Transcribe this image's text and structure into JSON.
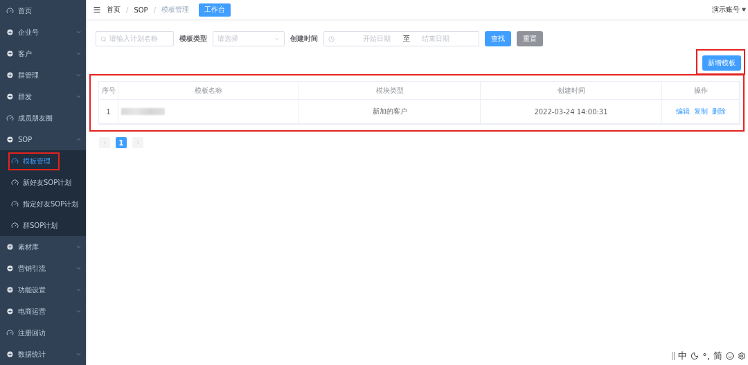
{
  "sidebar": {
    "items": [
      {
        "label": "首页",
        "kind": "link",
        "selected": false
      },
      {
        "label": "企业号",
        "kind": "group",
        "expanded": false,
        "selected": false
      },
      {
        "label": "客户",
        "kind": "group",
        "expanded": false,
        "selected": false
      },
      {
        "label": "群管理",
        "kind": "group",
        "expanded": false,
        "selected": false
      },
      {
        "label": "群发",
        "kind": "group",
        "expanded": false,
        "selected": false
      },
      {
        "label": "成员朋友圈",
        "kind": "link",
        "selected": false
      },
      {
        "label": "SOP",
        "kind": "group",
        "expanded": true,
        "selected": false,
        "children": [
          {
            "label": "模板管理",
            "selected": true,
            "highlighted": true
          },
          {
            "label": "新好友SOP计划",
            "selected": false,
            "highlighted": false
          },
          {
            "label": "指定好友SOP计划",
            "selected": false,
            "highlighted": false
          },
          {
            "label": "群SOP计划",
            "selected": false,
            "highlighted": false
          }
        ]
      },
      {
        "label": "素材库",
        "kind": "group",
        "expanded": false,
        "selected": false
      },
      {
        "label": "营销引流",
        "kind": "group",
        "expanded": false,
        "selected": false
      },
      {
        "label": "功能设置",
        "kind": "group",
        "expanded": false,
        "selected": false
      },
      {
        "label": "电商运营",
        "kind": "group",
        "expanded": false,
        "selected": false
      },
      {
        "label": "注册回访",
        "kind": "link",
        "selected": false
      },
      {
        "label": "数据统计",
        "kind": "group",
        "expanded": false,
        "selected": false
      }
    ]
  },
  "header": {
    "breadcrumb": [
      "首页",
      "SOP",
      "模板管理"
    ],
    "breadcrumb_separators": [
      "/",
      "/"
    ],
    "workbench_button": "工作台",
    "account": "演示账号"
  },
  "filters": {
    "name_placeholder": "请输入计划名称",
    "type_label": "模板类型",
    "type_placeholder": "请选择",
    "time_label": "创建时间",
    "start_placeholder": "开始日期",
    "range_separator": "至",
    "end_placeholder": "结束日期",
    "search_button": "查找",
    "reset_button": "重置"
  },
  "new_button": {
    "label": "新增模板",
    "highlighted": true
  },
  "table": {
    "highlighted": true,
    "columns": [
      "序号",
      "模板名称",
      "模块类型",
      "创建时间",
      "操作"
    ],
    "rows": [
      {
        "index": "1",
        "name_blurred": true,
        "type": "新加的客户",
        "created": "2022-03-24 14:00:31",
        "actions": [
          "编辑",
          "复制",
          "删除"
        ]
      }
    ]
  },
  "pagination": {
    "pages": [
      {
        "label": "1",
        "selected": true
      }
    ]
  },
  "ime_bar": {
    "items": [
      {
        "kind": "text",
        "label": "中"
      },
      {
        "kind": "moon"
      },
      {
        "kind": "text",
        "label": "°,"
      },
      {
        "kind": "text",
        "label": "简"
      },
      {
        "kind": "smile"
      },
      {
        "kind": "gear"
      }
    ]
  }
}
